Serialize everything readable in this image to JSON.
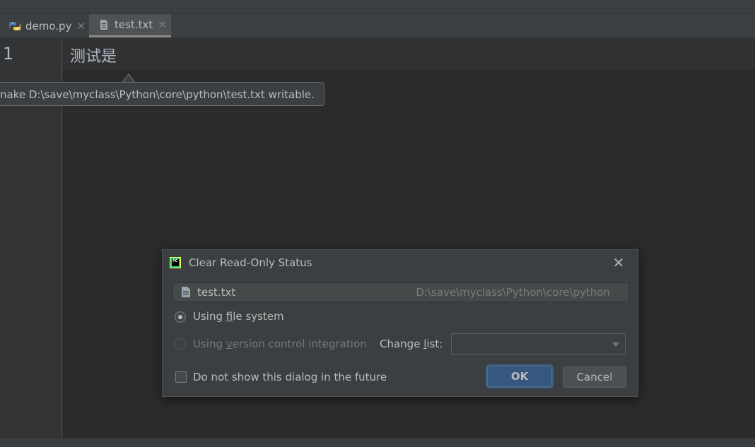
{
  "tabs": [
    {
      "label": "demo.py",
      "icon": "python-file-icon",
      "active": false
    },
    {
      "label": "test.txt",
      "icon": "text-file-icon",
      "active": true
    }
  ],
  "editor": {
    "line_number": "1",
    "content": "测试是"
  },
  "tooltip": {
    "text": "nake D:\\save\\myclass\\Python\\core\\python\\test.txt writable."
  },
  "dialog": {
    "title": "Clear Read-Only Status",
    "file_name": "test.txt",
    "file_path": "D:\\save\\myclass\\Python\\core\\python",
    "option_file_system": {
      "pre": "Using ",
      "mnemonic": "f",
      "post": "ile system",
      "selected": true
    },
    "option_vcs": {
      "pre": "Using ",
      "mnemonic": "v",
      "post": "ersion control integration",
      "selected": false,
      "enabled": false
    },
    "change_list": {
      "pre": "Change ",
      "mnemonic": "l",
      "post": "ist:",
      "value": ""
    },
    "do_not_show": {
      "label": "Do not show this dialog in the future",
      "checked": false
    },
    "ok_label": "OK",
    "cancel_label": "Cancel"
  },
  "colors": {
    "background": "#2b2b2b",
    "panel": "#3c3f41",
    "ok_button": "#365880",
    "text": "#bbbbbb"
  }
}
